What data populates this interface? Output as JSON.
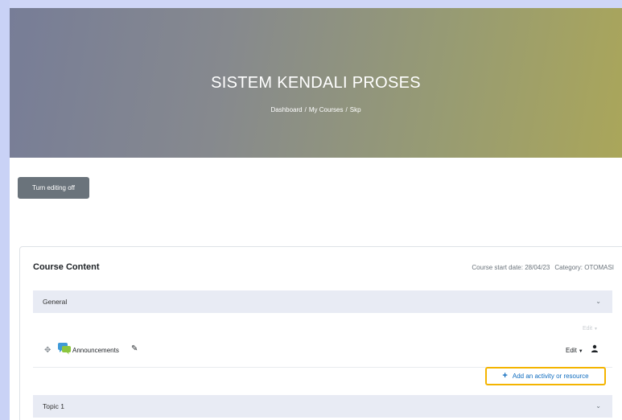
{
  "header": {
    "course_title": "SISTEM KENDALI PROSES",
    "breadcrumb": [
      "Dashboard",
      "My Courses",
      "Skp"
    ],
    "breadcrumb_separator": "/"
  },
  "toolbar": {
    "edit_mode_label": "Turn editing off"
  },
  "course_content": {
    "heading": "Course Content",
    "start_date": "Course start date: 28/04/23",
    "category": "Category: OTOMASI"
  },
  "sections": [
    {
      "name": "General",
      "section_edit_label": "Edit",
      "activities": [
        {
          "name": "Announcements",
          "edit_label": "Edit",
          "icon": "forum-icon"
        }
      ],
      "add_activity_label": "Add an activity or resource"
    },
    {
      "name": "Topic 1"
    }
  ],
  "colors": {
    "accent_blue": "#0f6cbf",
    "highlight_outline": "#f4b400",
    "section_bar": "#e8ebf4",
    "button_gray": "#6a737b"
  }
}
